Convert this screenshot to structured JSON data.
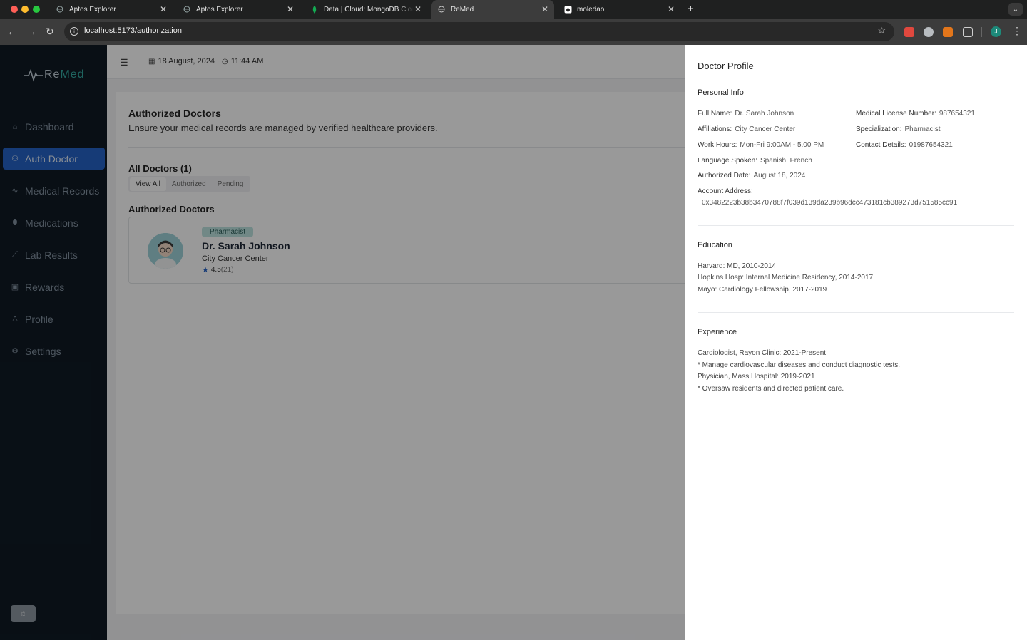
{
  "browser": {
    "tabs": [
      {
        "label": "Aptos Explorer",
        "active": false
      },
      {
        "label": "Aptos Explorer",
        "active": false
      },
      {
        "label": "Data | Cloud: MongoDB Cloud",
        "active": false
      },
      {
        "label": "ReMed",
        "active": true
      },
      {
        "label": "moledao",
        "active": false
      }
    ],
    "url": "localhost:5173/authorization",
    "profile_initial": "J"
  },
  "app": {
    "logo": {
      "part1": "Re",
      "part2": "Med"
    },
    "nav": [
      {
        "label": "Dashboard",
        "icon": "home-icon",
        "active": false
      },
      {
        "label": "Auth Doctor",
        "icon": "user-check-icon",
        "active": true
      },
      {
        "label": "Medical Records",
        "icon": "activity-icon",
        "active": false
      },
      {
        "label": "Medications",
        "icon": "pill-icon",
        "active": false
      },
      {
        "label": "Lab Results",
        "icon": "test-tube-icon",
        "active": false
      },
      {
        "label": "Rewards",
        "icon": "gift-icon",
        "active": false
      },
      {
        "label": "Profile",
        "icon": "user-icon",
        "active": false
      },
      {
        "label": "Settings",
        "icon": "gear-icon",
        "active": false
      }
    ],
    "header": {
      "date": "18 August, 2024",
      "time": "11:44 AM"
    },
    "page": {
      "title": "Authorized Doctors",
      "subtitle": "Ensure your medical records are managed by verified healthcare providers.",
      "all_doctors": "All Doctors (1)",
      "filters": [
        "View All",
        "Authorized",
        "Pending"
      ],
      "section_title": "Authorized Doctors",
      "doctor": {
        "badge": "Pharmacist",
        "name": "Dr. Sarah Johnson",
        "affiliation": "City Cancer Center",
        "rating": "4.5",
        "rating_count": "(21)"
      }
    }
  },
  "drawer": {
    "title": "Doctor Profile",
    "personal_info": {
      "heading": "Personal Info",
      "full_name_label": "Full Name:",
      "full_name": "Dr. Sarah Johnson",
      "license_label": "Medical License Number:",
      "license": "987654321",
      "affiliations_label": "Affiliations:",
      "affiliations": "City Cancer Center",
      "specialization_label": "Specialization:",
      "specialization": "Pharmacist",
      "hours_label": "Work Hours:",
      "hours": "Mon-Fri 9:00AM - 5.00 PM",
      "contact_label": "Contact Details:",
      "contact": "01987654321",
      "language_label": "Language Spoken:",
      "language": "Spanish, French",
      "auth_date_label": "Authorized Date:",
      "auth_date": "August 18, 2024",
      "address_label": "Account Address:",
      "address": "0x3482223b38b3470788f7f039d139da239b96dcc473181cb389273d751585cc91"
    },
    "education": {
      "heading": "Education",
      "lines": [
        "Harvard: MD, 2010-2014",
        "Hopkins Hosp: Internal Medicine Residency, 2014-2017",
        "Mayo: Cardiology Fellowship, 2017-2019"
      ]
    },
    "experience": {
      "heading": "Experience",
      "lines": [
        "Cardiologist, Rayon Clinic: 2021-Present",
        "* Manage cardiovascular diseases and conduct diagnostic tests.",
        "Physician, Mass Hospital: 2019-2021",
        "* Oversaw residents and directed patient care."
      ]
    }
  }
}
